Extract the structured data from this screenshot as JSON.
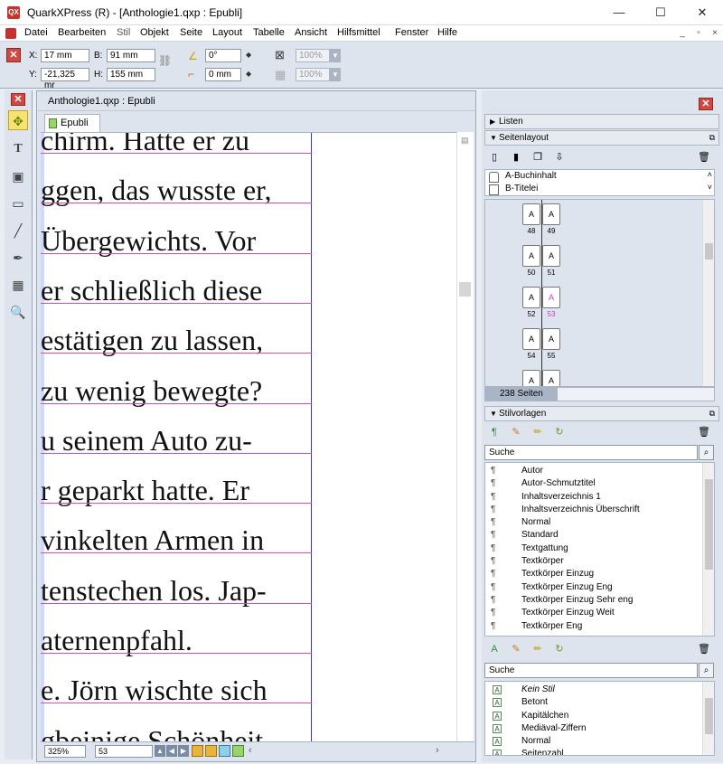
{
  "window": {
    "title": "QuarkXPress (R) - [Anthologie1.qxp : Epubli]",
    "min_label": "—",
    "max_label": "☐",
    "close_label": "✕"
  },
  "menu": {
    "items": [
      "Datei",
      "Bearbeiten",
      "Stil",
      "Objekt",
      "Seite",
      "Layout",
      "Tabelle",
      "Ansicht",
      "Hilfsmittel",
      "Fenster",
      "Hilfe"
    ]
  },
  "measurements": {
    "x_label": "X:",
    "x_value": "17 mm",
    "y_label": "Y:",
    "y_value": "-21,325 mr",
    "b_label": "B:",
    "b_value": "91 mm",
    "h_label": "H:",
    "h_value": "155 mm",
    "angle_value": "0°",
    "corner_value": "0 mm",
    "opacity1": "100%",
    "opacity2": "100%"
  },
  "document": {
    "title": "Anthologie1.qxp : Epubli",
    "tab": "Epubli",
    "lines": [
      "chirm. Hatte er zu",
      "ggen, das wusste er,",
      "Übergewichts. Vor",
      "er schließlich diese",
      "estätigen zu lassen,",
      "zu wenig bewegte?",
      "u seinem Auto zu-",
      "r geparkt hatte. Er",
      "vinkelten Armen in",
      "tenstechen los. Jap-",
      "aternenpfahl.",
      "e. Jörn wischte sich",
      "gbeinige Schönheit"
    ],
    "zoom": "325%",
    "page": "53"
  },
  "panels": {
    "close_label": "✕",
    "listen": "Listen",
    "seitenlayout": "Seitenlayout",
    "masters": [
      "A-Buchinhalt",
      "B-Titelei"
    ],
    "pages_count": "238 Seiten",
    "spread_pages": [
      {
        "left": "48",
        "right": "49"
      },
      {
        "left": "50",
        "right": "51"
      },
      {
        "left": "52",
        "right": "53"
      },
      {
        "left": "54",
        "right": "55"
      }
    ],
    "page_letter": "A",
    "stilvorlagen": "Stilvorlagen",
    "search_placeholder": "Suche",
    "paragraph_styles": [
      "Autor",
      "Autor-Schmutztitel",
      "Inhaltsverzeichnis 1",
      "Inhaltsverzeichnis Überschrift",
      "Normal",
      "Standard",
      "Textgattung",
      "Textkörper",
      "Textkörper Einzug",
      "Textkörper Einzug Eng",
      "Textkörper Einzug Sehr eng",
      "Textkörper Einzug Weit",
      "Textkörper Eng"
    ],
    "char_search_placeholder": "Suche",
    "char_styles": [
      "Kein Stil",
      "Betont",
      "Kapitälchen",
      "Mediäval-Ziffern",
      "Normal",
      "Seitenzahl"
    ],
    "colors": {
      "magenta": "#cc33cc",
      "baseline": "#e04aa8",
      "margin": "#3a3aa8"
    }
  }
}
